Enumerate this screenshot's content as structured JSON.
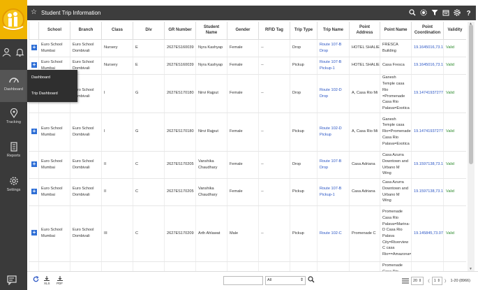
{
  "window": {
    "title": "Student Trip Information"
  },
  "sidebar": {
    "items": [
      {
        "label": "Dashboard",
        "icon": "dashboard-icon",
        "active": true
      },
      {
        "label": "Tracking",
        "icon": "location-pin-icon"
      },
      {
        "label": "Reports",
        "icon": "report-icon"
      },
      {
        "label": "Settings",
        "icon": "gear-icon"
      }
    ]
  },
  "flyout": {
    "items": [
      "Dashboard",
      "Trip Dashboard"
    ]
  },
  "table": {
    "columns": [
      "",
      "School",
      "Branch",
      "Class",
      "Div",
      "GR Number",
      "Student Name",
      "Gender",
      "RFID Tag",
      "Trip Type",
      "Trip Name",
      "Point Address",
      "Point Name",
      "Point Coordination",
      "Validity"
    ],
    "rows": [
      {
        "school": "Euro School Mumbai",
        "branch": "Euro School Dombivali",
        "class": "Nursery",
        "div": "E",
        "gr": "2627ES160039",
        "student": "Nyra Kashyap",
        "gender": "Female",
        "rfid": "--",
        "trip_type": "Drop",
        "trip_name": "Route 107-B Drop",
        "address": "HOTEL SHALIE",
        "point_name": "FRESCA Building",
        "coord": "19.1645016,73.11",
        "validity": "Valid"
      },
      {
        "school": "Euro School Mumbai",
        "branch": "Euro School Dombivali",
        "class": "Nursery",
        "div": "E",
        "gr": "2627ES160039",
        "student": "Nyra Kashyap",
        "gender": "Female",
        "rfid": "--",
        "trip_type": "Pickup",
        "trip_name": "Route 107-B Pickup-1",
        "address": "HOTEL SHALIE",
        "point_name": "Casa Fresca",
        "coord": "19.1645016,73.11",
        "validity": "Valid"
      },
      {
        "school": "Euro School Mumbai",
        "branch": "Euro School Dombivali",
        "class": "I",
        "div": "G",
        "gr": "2627ES170180",
        "student": "Nirvi Rajput",
        "gender": "Female",
        "rfid": "--",
        "trip_type": "Drop",
        "trip_name": "Route 102-D Drop",
        "address": "A, Casa Rio Mi",
        "point_name": "Ganesh Temple casa Rio =Promenade Casa Rio Palava=Exotica",
        "coord": "19.147419372779",
        "validity": "Valid"
      },
      {
        "school": "Euro School Mumbai",
        "branch": "Euro School Dombivali",
        "class": "I",
        "div": "G",
        "gr": "2627ES170180",
        "student": "Nirvi Rajput",
        "gender": "Female",
        "rfid": "--",
        "trip_type": "Pickup",
        "trip_name": "Route 102-D Pickup",
        "address": "A, Casa Rio Mi",
        "point_name": "Ganesh Temple casa Rio=Promenade Casa Rio Palava=Exotica",
        "coord": "19.147419372779",
        "validity": "Valid"
      },
      {
        "school": "Euro School Mumbai",
        "branch": "Euro School Dombivali",
        "class": "II",
        "div": "C",
        "gr": "2627ES170205",
        "student": "Vanshika Chaudhary",
        "gender": "Female",
        "rfid": "--",
        "trip_type": "Drop",
        "trip_name": "Route 107-B Drop",
        "address": "Casa Adriana",
        "point_name": "Casa Azurra Downtown and Urbano M Wing",
        "coord": "19.1597138,73.11",
        "validity": "Valid"
      },
      {
        "school": "Euro School Mumbai",
        "branch": "Euro School Dombivali",
        "class": "II",
        "div": "C",
        "gr": "2627ES170205",
        "student": "Vanshika Chaudhary",
        "gender": "Female",
        "rfid": "--",
        "trip_type": "Pickup",
        "trip_name": "Route 107-B Pickup-1",
        "address": "Casa Adriana",
        "point_name": "Casa Azurra Downtown and Urbano M Wing",
        "coord": "19.1597138,73.11",
        "validity": "Valid"
      },
      {
        "school": "Euro School Mumbai",
        "branch": "Euro School Dombivali",
        "class": "III",
        "div": "C",
        "gr": "2627ES170209",
        "student": "Arth Ahlawat",
        "gender": "Male",
        "rfid": "--",
        "trip_type": "Pickup",
        "trip_name": "Route 102-C",
        "address": "Promenade C",
        "point_name": "Promenade Casa Rio Palava=Marina-D Casa Rio Palava City=Riverview C casa Rio==Amazona=Riverscape",
        "coord": "19.145845,73.079",
        "validity": "Valid"
      },
      {
        "school": "",
        "branch": "",
        "class": "",
        "div": "",
        "gr": "",
        "student": "",
        "gender": "",
        "rfid": "",
        "trip_type": "",
        "trip_name": "",
        "address": "",
        "point_name": "Promenade Casa Rio",
        "coord": "",
        "validity": ""
      }
    ]
  },
  "footer": {
    "xls_label": "XLS",
    "pdf_label": "PDF",
    "filter_value": "All",
    "page_size": "20",
    "page_number": "1",
    "range_text": "1-20 (8966)"
  }
}
